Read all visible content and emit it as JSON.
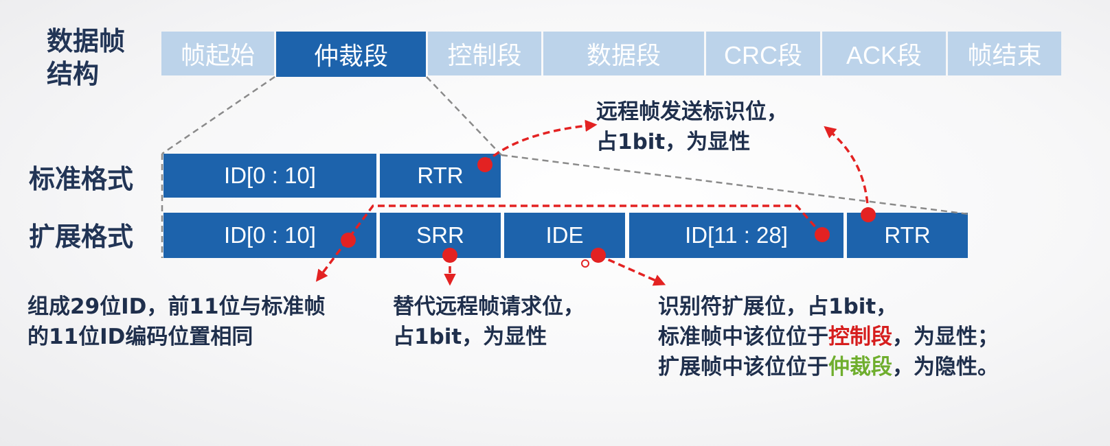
{
  "frame_title": "数据帧\n结构",
  "top_segments": [
    {
      "label": "帧起始",
      "active": false
    },
    {
      "label": "仲裁段",
      "active": true
    },
    {
      "label": "控制段",
      "active": false
    },
    {
      "label": "数据段",
      "active": false
    },
    {
      "label": "CRC段",
      "active": false
    },
    {
      "label": "ACK段",
      "active": false
    },
    {
      "label": "帧结束",
      "active": false
    }
  ],
  "standard": {
    "label": "标准格式",
    "fields": [
      "ID[0 : 10]",
      "RTR"
    ]
  },
  "extended": {
    "label": "扩展格式",
    "fields": [
      "ID[0 : 10]",
      "SRR",
      "IDE",
      "ID[11 : 28]",
      "RTR"
    ]
  },
  "notes": {
    "rtr_note": "远程帧发送标识位，\n占1bit，为显性",
    "id_note": "组成29位ID，前11位与标准帧\n的11位ID编码位置相同",
    "srr_note": "替代远程帧请求位，\n占1bit，为显性",
    "ide_line1": "识别符扩展位，占1bit，",
    "ide_line2_pre": "标准帧中该位位于",
    "ide_line2_hl": "控制段",
    "ide_line2_post": "，为显性；",
    "ide_line3_pre": "扩展帧中该位位于",
    "ide_line3_hl": "仲裁段",
    "ide_line3_post": "，为隐性。"
  },
  "colors": {
    "field_blue": "#1d63ac",
    "light_blue": "#bcd3ea",
    "text_dark": "#223556",
    "marker_red": "#e32222",
    "highlight_red": "#d61e1e",
    "highlight_green": "#6fae2e"
  }
}
